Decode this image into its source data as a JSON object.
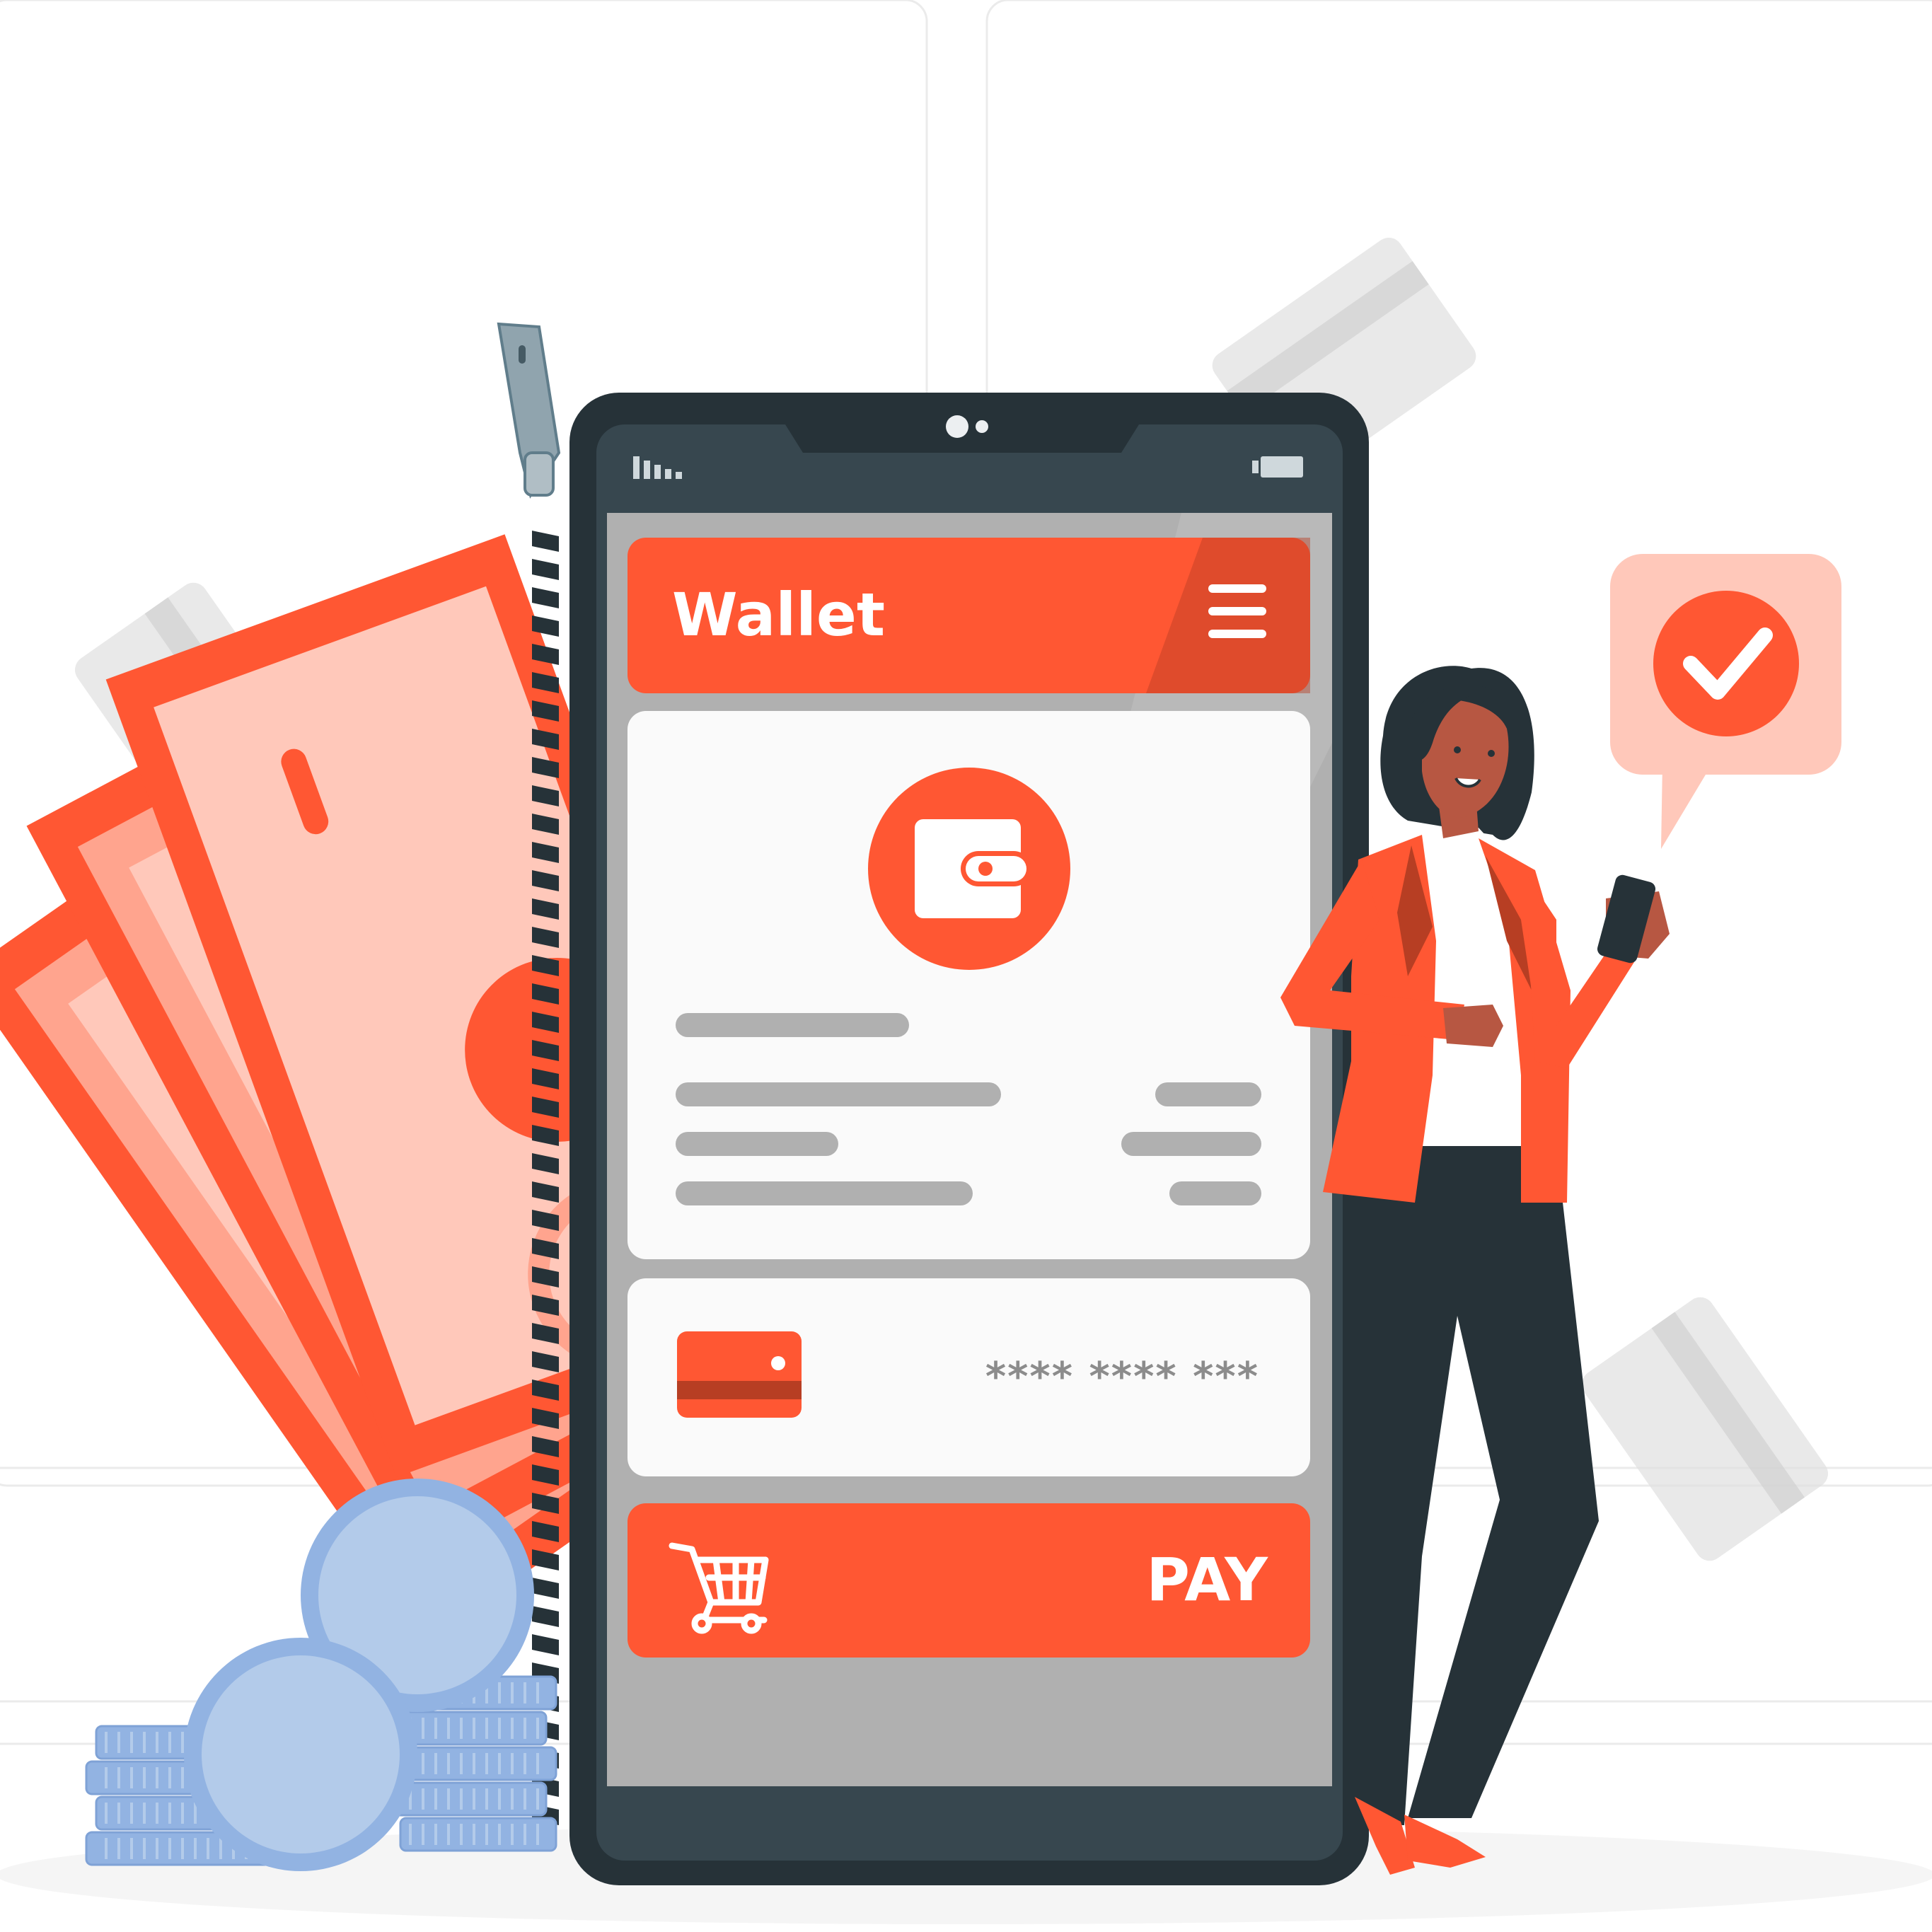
{
  "app": {
    "header_title": "Wallet",
    "card_number_masked": "**** **** ***",
    "pay_label": "PAY"
  },
  "icons": {
    "menu": "hamburger-menu-icon",
    "wallet": "wallet-icon",
    "card": "credit-card-icon",
    "cart": "shopping-cart-icon",
    "confirm": "check-circle-icon",
    "zipper": "zipper-pull-icon"
  },
  "colors": {
    "accent": "#FF5733",
    "accent_dark": "#B73E23",
    "accent_light": "#FFC8BA",
    "phone_body": "#263238",
    "phone_bezel": "#37474F",
    "screen_bg": "#B0B0B0",
    "panel_bg": "#FAFAFA",
    "placeholder": "#B0B0B0",
    "coin_blue": "#92B3E2",
    "coin_light": "#B3CBEA",
    "badge_bg": "#FFC8BA"
  }
}
